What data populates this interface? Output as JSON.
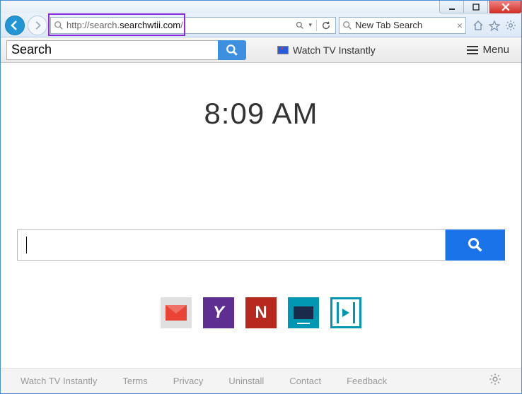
{
  "window": {
    "minimize_icon": "minimize",
    "maximize_icon": "maximize",
    "close_icon": "close"
  },
  "browser": {
    "url_prefix": "http://search.",
    "url_domain": "searchwtii.com",
    "url_suffix": "/",
    "tab_title": "New Tab Search"
  },
  "toolbar": {
    "search_value": "Search",
    "watch_tv_label": "Watch TV Instantly",
    "menu_label": "Menu"
  },
  "page": {
    "clock": "8:09 AM",
    "big_search_value": "",
    "tiles": {
      "gmail": "M",
      "yahoo": "Y",
      "netflix": "N"
    }
  },
  "footer": {
    "links": [
      "Watch TV Instantly",
      "Terms",
      "Privacy",
      "Uninstall",
      "Contact",
      "Feedback"
    ]
  }
}
